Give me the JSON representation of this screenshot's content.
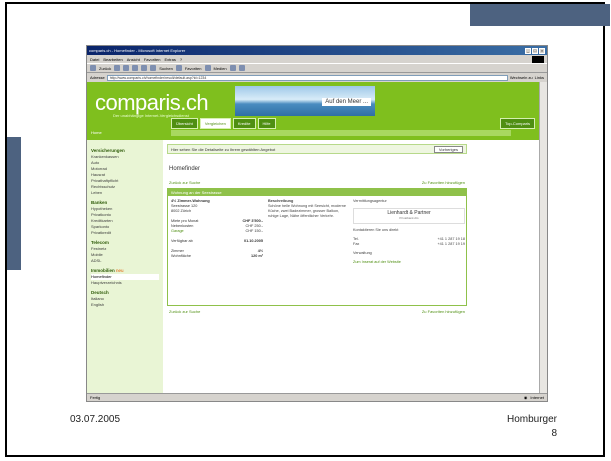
{
  "slide": {
    "date": "03.07.2005",
    "author": "Homburger",
    "page": "8"
  },
  "browser": {
    "title": "comparis.ch - Homefinder - Microsoft Internet Explorer",
    "menu": [
      "Datei",
      "Bearbeiten",
      "Ansicht",
      "Favoriten",
      "Extras",
      "?"
    ],
    "toolbar": [
      "Zurück",
      "Suchen",
      "Favoriten",
      "Medien"
    ],
    "address_label": "Adresse",
    "address": "http://www.comparis.ch/homefinder/result/default.asp?id=1234",
    "go_label": "Wechseln zu",
    "links_label": "Links",
    "status": "Fertig",
    "zone": "Internet"
  },
  "site": {
    "logo": "comparis.ch",
    "logo_sub": "Der unabhängige Internet-Vergleichsdienst",
    "banner_text": "Auf den Meer ...",
    "nav": [
      "Übersicht",
      "Vergleichen",
      "Kredite",
      "Hilfe"
    ],
    "nav_right": "Top-Comparis",
    "home": "Home",
    "left": [
      {
        "head": "Versicherungen",
        "items": [
          "Krankenkassen",
          "Auto",
          "Motorrad",
          "Hausrat",
          "Privathaftpflicht",
          "Rechtsschutz",
          "Leben"
        ]
      },
      {
        "head": "Banken",
        "items": [
          "Hypotheken",
          "Privatkonto",
          "Kreditkarten",
          "Sparkonto",
          "Privatkredit"
        ]
      },
      {
        "head": "Telecom",
        "items": [
          "Festnetz",
          "Mobile",
          "ADSL"
        ]
      },
      {
        "head": "Immobilien",
        "items": [
          "Homefinder",
          "Hauptverzeichnis"
        ],
        "new_tag": "neu"
      },
      {
        "head": "Deutsch",
        "items": [
          "Italiano",
          "English"
        ]
      }
    ],
    "infobar_text": "Hier sehen Sie die Detailseite zu Ihrem gewählten Angebot",
    "infobar_button": "Vorheriges",
    "page_title": "Homefinder",
    "back_link": "Zurück zur Suche",
    "fav_link": "Zu Favoriten hinzufügen",
    "listing_head": "Wohnung an der Seestrasse",
    "col1_lines": [
      "4½ Zimmer-Wohnung",
      "Seestrasse 120",
      "8002 Zürich"
    ],
    "prices": [
      {
        "label": "Miete pro Monat",
        "value": "CHF 3'500.-"
      },
      {
        "label": "Nebenkosten",
        "value": "CHF 250.-"
      },
      {
        "label": "Garage",
        "value": "CHF 150.-"
      }
    ],
    "available_label": "Verfügbar ab",
    "available_value": "01.10.2005",
    "rooms_label": "Zimmer",
    "rooms_value": "4½",
    "area_label": "Wohnfläche",
    "area_value": "120 m²",
    "desc_head": "Beschreibung",
    "desc": "Schöne helle Wohnung mit Seesicht, moderne Küche, zwei Badezimmer, grosser Balkon, ruhige Lage, Nähe öffentlicher Verkehr.",
    "agency_head": "Vermittlungsagentur",
    "agency_name": "Lienhardt & Partner",
    "agency_sub": "Privatbank AG",
    "contact_note": "Kontaktieren Sie uns direkt",
    "contacts": [
      {
        "label": "Tel.",
        "value": "+41 1 287 19 18"
      },
      {
        "label": "Fax",
        "value": "+41 1 287 19 19"
      }
    ],
    "contact_person": "Verwaltung",
    "contact_link": "Zum Inserat auf der Website"
  }
}
